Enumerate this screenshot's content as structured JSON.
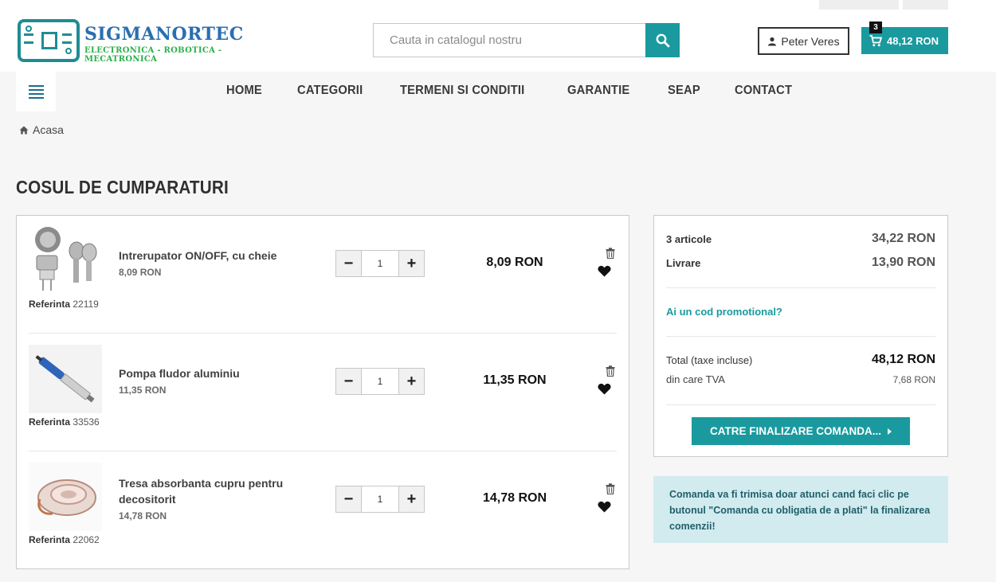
{
  "header": {
    "logo_name": "SIGMANORTEC",
    "logo_tagline": "ELECTRONICA - ROBOTICA - MECATRONICA",
    "search_placeholder": "Cauta in catalogul nostru",
    "account_name": "Peter Veres",
    "cart_count": "3",
    "cart_total": "48,12 RON"
  },
  "nav": {
    "items": [
      "HOME",
      "CATEGORII",
      "TERMENI SI CONDITII",
      "GARANTIE",
      "SEAP",
      "CONTACT"
    ]
  },
  "breadcrumb": {
    "home": "Acasa"
  },
  "page": {
    "title": "COSUL DE CUMPARATURI"
  },
  "cart": {
    "reference_label": "Referinta",
    "items": [
      {
        "name": "Intrerupator ON/OFF, cu cheie",
        "unit_price": "8,09 RON",
        "reference": "22119",
        "quantity": "1",
        "line_total": "8,09 RON"
      },
      {
        "name": "Pompa fludor aluminiu",
        "unit_price": "11,35 RON",
        "reference": "33536",
        "quantity": "1",
        "line_total": "11,35 RON"
      },
      {
        "name": "Tresa absorbanta cupru pentru decositorit",
        "unit_price": "14,78 RON",
        "reference": "22062",
        "quantity": "1",
        "line_total": "14,78 RON"
      }
    ]
  },
  "summary": {
    "items_label": "3 articole",
    "items_value": "34,22 RON",
    "shipping_label": "Livrare",
    "shipping_value": "13,90 RON",
    "promo_link": "Ai un cod promotional?",
    "total_label": "Total (taxe incluse)",
    "total_value": "48,12 RON",
    "vat_label": "din care TVA",
    "vat_value": "7,68 RON",
    "checkout_label": "CATRE FINALIZARE COMANDA..."
  },
  "notice": {
    "text": "Comanda va fi trimisa doar atunci cand faci clic pe butonul \"Comanda cu obligatia de a plati\" la finalizarea comenzii!"
  },
  "colors": {
    "accent": "#1a9a9e",
    "notice_bg": "#d2ebef",
    "logo_blue": "#2a6fb0",
    "logo_green": "#2bb04a"
  }
}
